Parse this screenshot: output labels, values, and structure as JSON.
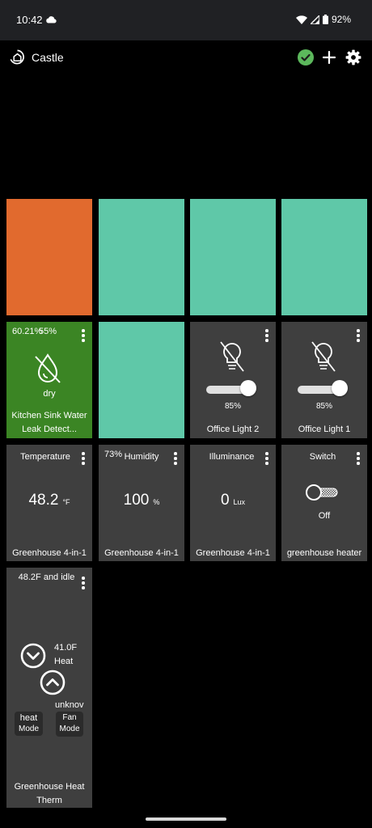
{
  "status_bar": {
    "time": "10:42",
    "battery": "92%"
  },
  "app": {
    "title": "Castle"
  },
  "colors": {
    "orange": "#e16a2e",
    "teal": "#5fc8a8",
    "green": "#3b8524",
    "tile_gray": "#3f3f3f"
  },
  "tiles": {
    "leak": {
      "top_left": "60.21%",
      "top_right": "55%",
      "state": "dry",
      "name_line1": "Kitchen Sink Water",
      "name_line2": "Leak Detect..."
    },
    "office_light_2": {
      "level": "85%",
      "level_value": 0.85,
      "name": "Office Light 2"
    },
    "office_light_1": {
      "level": "85%",
      "level_value": 0.85,
      "name": "Office Light 1"
    },
    "temperature": {
      "title": "Temperature",
      "value": "48.2",
      "unit": "°F",
      "name": "Greenhouse 4-in-1"
    },
    "humidity": {
      "badge": "73%",
      "title": "Humidity",
      "value": "100",
      "unit": "%",
      "name": "Greenhouse 4-in-1"
    },
    "illuminance": {
      "title": "Illuminance",
      "value": "0",
      "unit": "Lux",
      "name": "Greenhouse 4-in-1"
    },
    "switch": {
      "title": "Switch",
      "state": "Off",
      "name": "greenhouse heater"
    },
    "thermostat": {
      "header": "48.2F and idle",
      "setpoint": "41.0F",
      "setpoint_mode": "Heat",
      "mode_value": "heat",
      "mode_label": "Mode",
      "fan_value": "unknov",
      "fan_label_line1": "Fan",
      "fan_label_line2": "Mode",
      "name_line1": "Greenhouse Heat",
      "name_line2": "Therm"
    }
  }
}
